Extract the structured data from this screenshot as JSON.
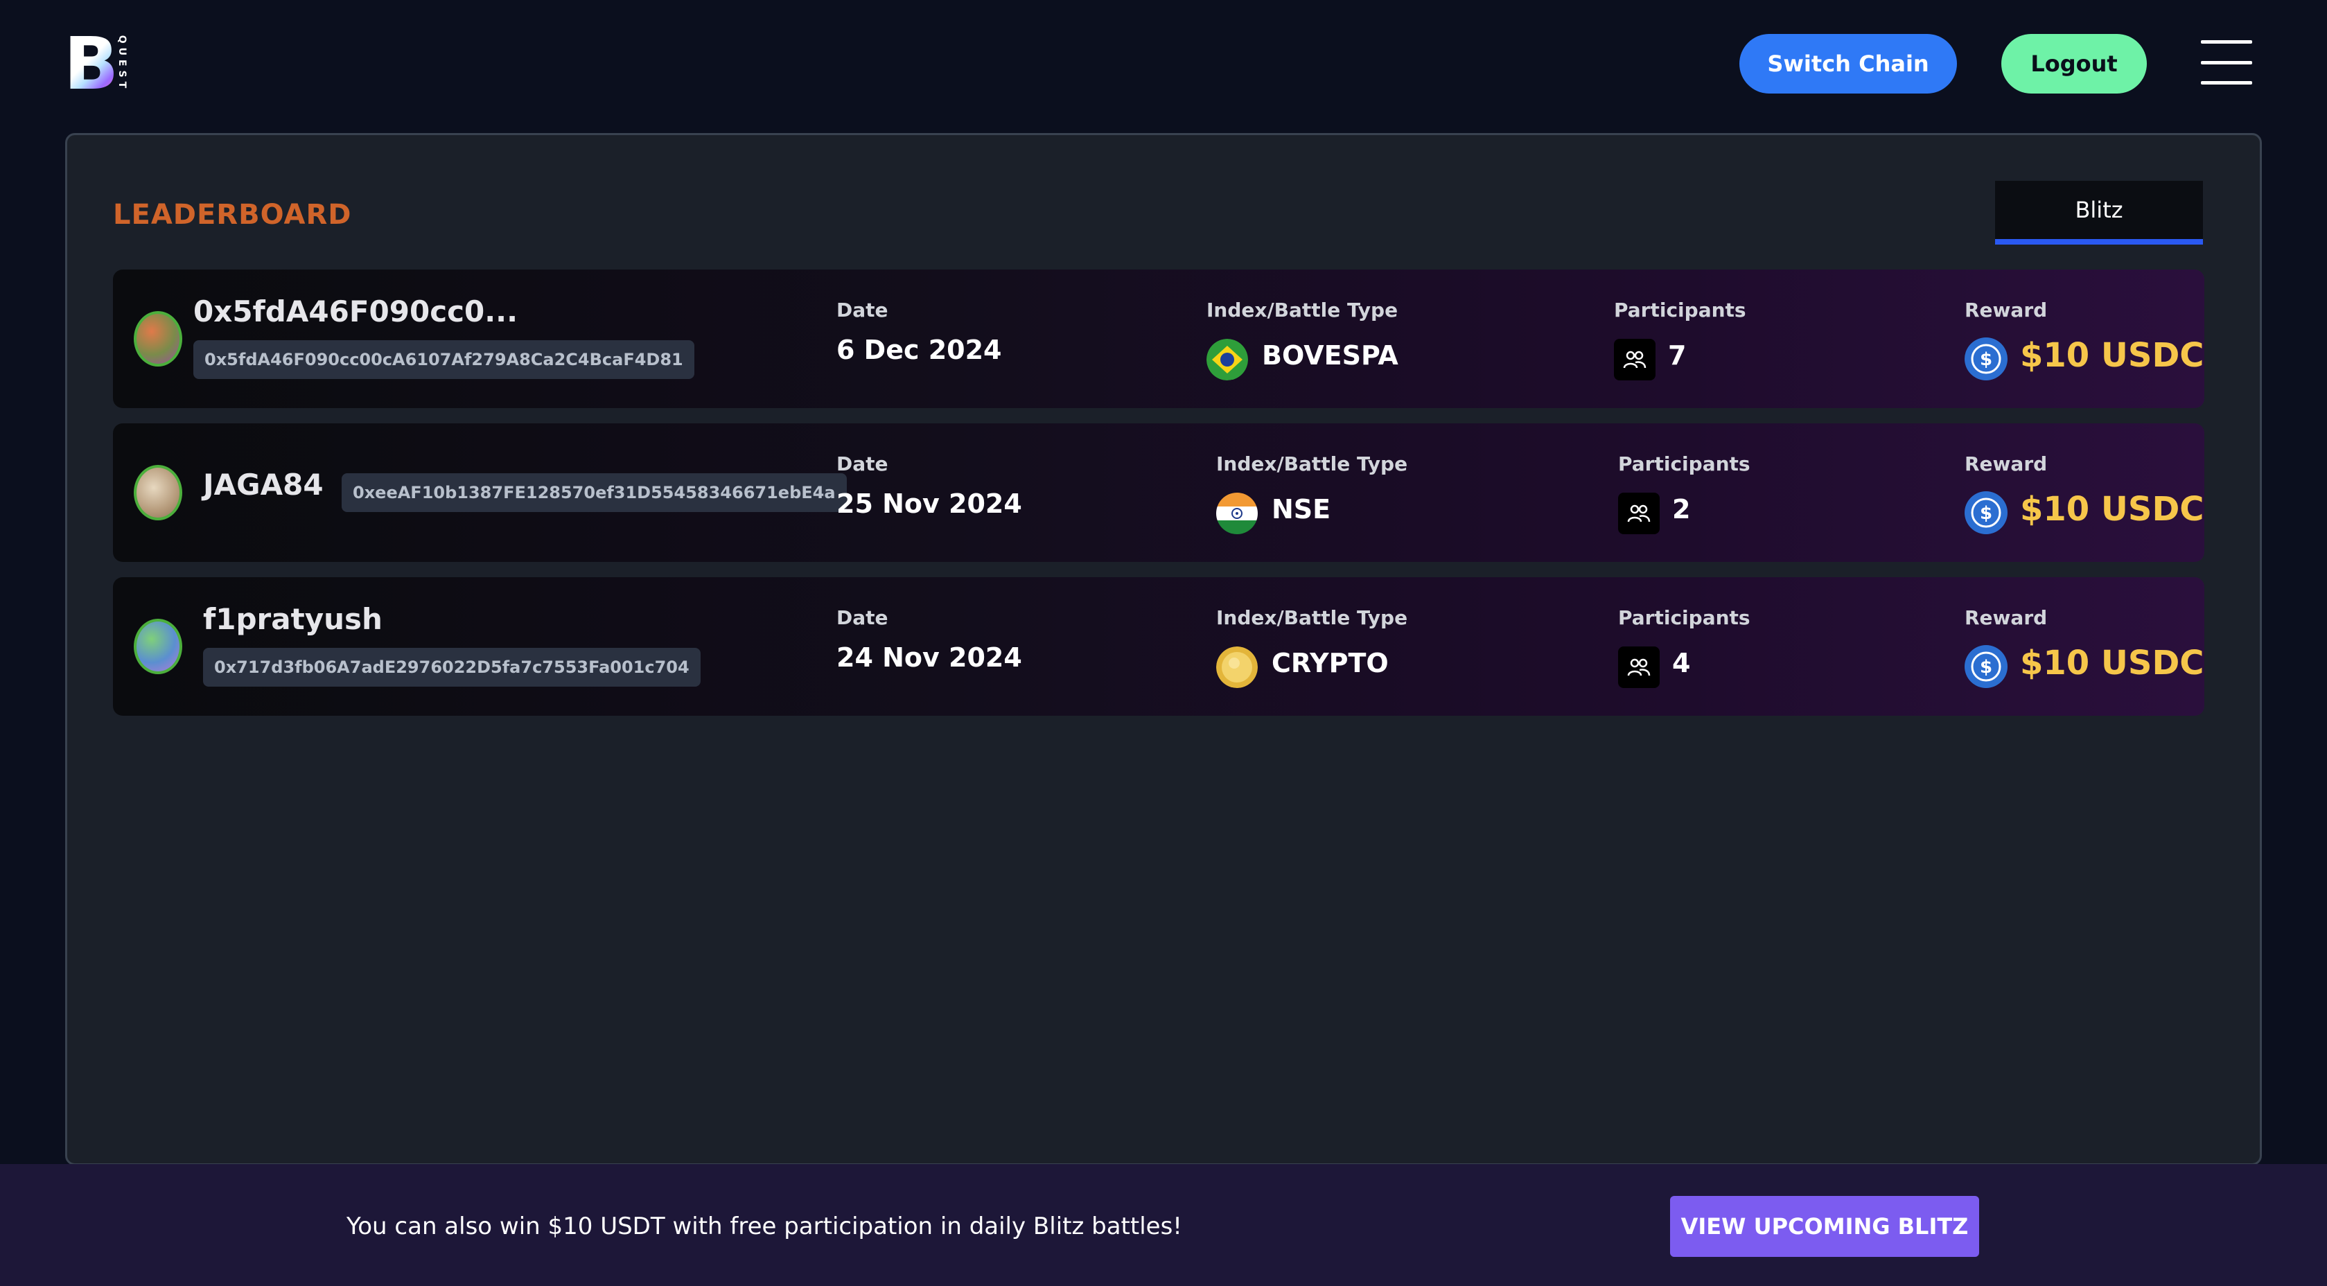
{
  "header": {
    "logo_letter": "B",
    "logo_word": "QUEST",
    "switch_chain_label": "Switch Chain",
    "logout_label": "Logout"
  },
  "leaderboard": {
    "title": "LEADERBOARD",
    "active_tab": "Blitz",
    "labels": {
      "date": "Date",
      "index": "Index/Battle Type",
      "participants": "Participants",
      "reward": "Reward"
    },
    "rows": [
      {
        "name": "0x5fdA46F090cc0...",
        "address": "0x5fdA46F090cc00cA6107Af279A8Ca2C4BcaF4D81",
        "date": "6 Dec 2024",
        "index": "BOVESPA",
        "participants": "7",
        "reward": "$10 USDC"
      },
      {
        "name": "JAGA84",
        "address": "0xeeAF10b1387FE128570ef31D55458346671ebE4a",
        "date": "25 Nov 2024",
        "index": "NSE",
        "participants": "2",
        "reward": "$10 USDC"
      },
      {
        "name": "f1pratyush",
        "address": "0x717d3fb06A7adE2976022D5fa7c7553Fa001c704",
        "date": "24 Nov 2024",
        "index": "CRYPTO",
        "participants": "4",
        "reward": "$10 USDC"
      }
    ]
  },
  "footer": {
    "message": "You can also win $10 USDT with free participation in daily Blitz battles!",
    "button_label": "VIEW UPCOMING BLITZ"
  },
  "colors": {
    "accent_blue": "#2f79f6",
    "accent_green": "#6ef2a7",
    "title_orange": "#d0642a",
    "reward_gold": "#f6c64a",
    "cta_purple": "#7c5cf0"
  }
}
